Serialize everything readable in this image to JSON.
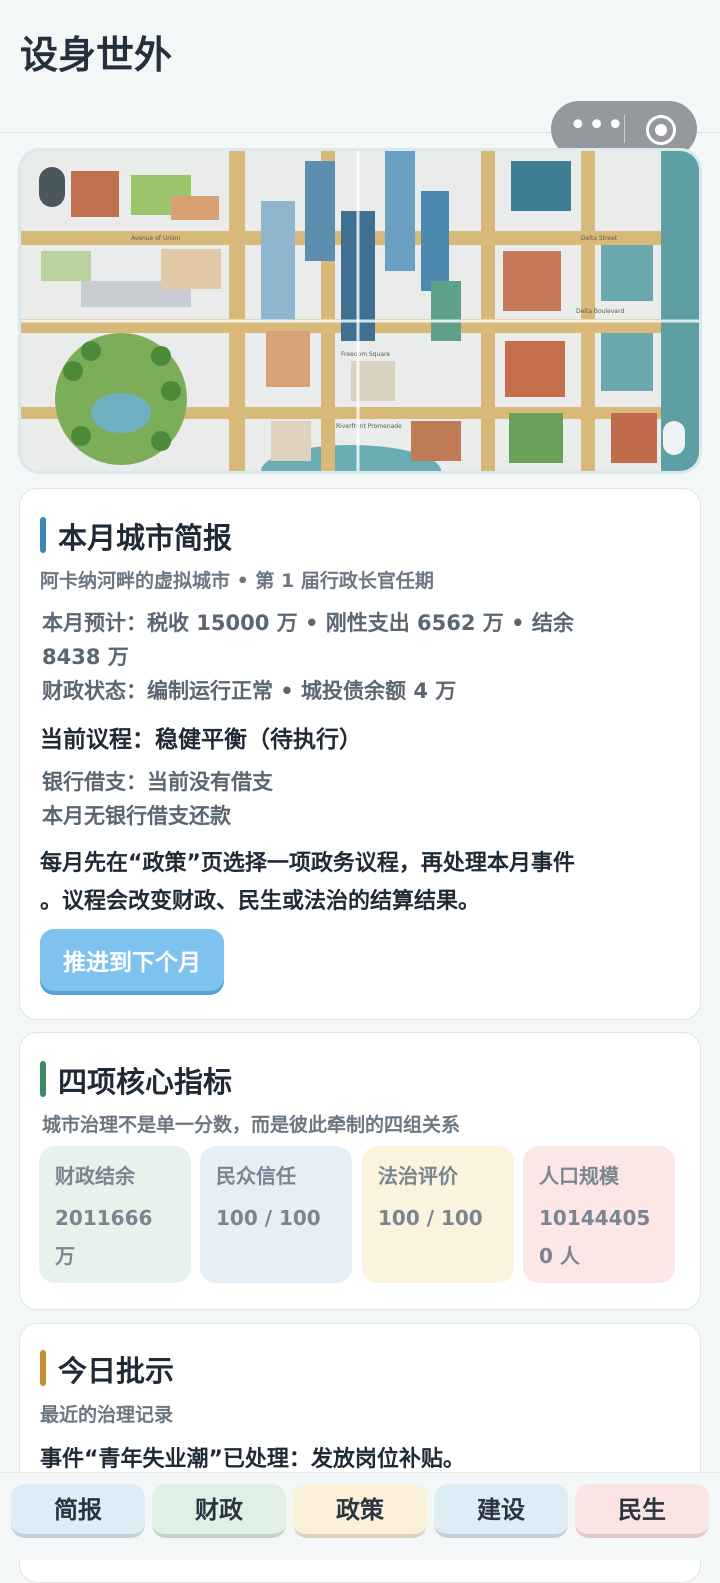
{
  "app": {
    "title": "设身世外"
  },
  "capsule": {
    "more_icon": "more-dots-icon",
    "close_icon": "target-circle-icon"
  },
  "map": {
    "labels": {
      "avenue": "Avenue of Union",
      "delta_street": "Delta Street",
      "delta_boulevard": "Delta Boulevard",
      "freedom_square": "Freedom Square",
      "riverfront": "Riverfront Promenade"
    }
  },
  "briefing": {
    "title": "本月城市简报",
    "subtitle": "阿卡纳河畔的虚拟城市 • 第 1 届行政长官任期",
    "forecast_line1": "本月预计：税收 15000 万 • 刚性支出 6562 万 • 结余",
    "forecast_line2": "8438 万",
    "fiscal_status": "财政状态：编制运行正常 • 城投债余额 4 万",
    "agenda": "当前议程：稳健平衡（待执行）",
    "bank_loan": "银行借支：当前没有借支",
    "repayment": "本月无银行借支还款",
    "hint_line1": "每月先在“政策”页选择一项政务议程，再处理本月事件",
    "hint_line2": "。议程会改变财政、民生或法治的结算结果。",
    "advance_button": "推进到下个月"
  },
  "core": {
    "title": "四项核心指标",
    "subtitle": "城市治理不是单一分数，而是彼此牵制的四组关系",
    "metrics": [
      {
        "label": "财政结余",
        "value": "2011666 万",
        "color": "#e6f3ec"
      },
      {
        "label": "民众信任",
        "value": "100 / 100",
        "color": "#e4eff7"
      },
      {
        "label": "法治评价",
        "value": "100 / 100",
        "color": "#fbf3de"
      },
      {
        "label": "人口规模",
        "value": "101444050 人",
        "color": "#fbe8e6"
      }
    ]
  },
  "today": {
    "title": "今日批示",
    "subtitle": "最近的治理记录",
    "record": "事件“青年失业潮”已处理：发放岗位补贴。"
  },
  "tabs": [
    {
      "label": "简报",
      "color": "#deecf5"
    },
    {
      "label": "财政",
      "color": "#e0f0e6"
    },
    {
      "label": "政策",
      "color": "#fbf1d9"
    },
    {
      "label": "建设",
      "color": "#deecf5"
    },
    {
      "label": "民生",
      "color": "#fbe5e4"
    }
  ],
  "accents": {
    "briefing": "#3d86b8",
    "core": "#3c8a64",
    "today": "#c98d34"
  }
}
